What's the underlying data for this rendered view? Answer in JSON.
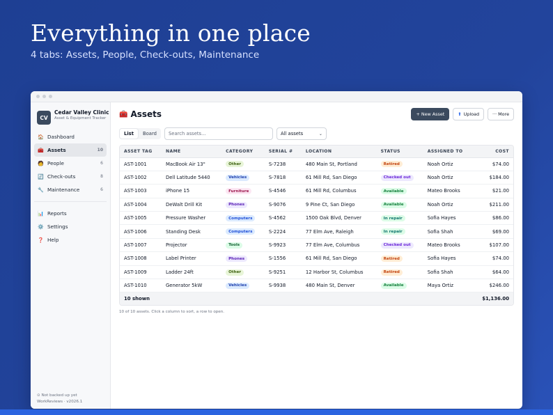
{
  "hero": {
    "title": "Everything in one place",
    "subtitle": "4 tabs: Assets, People, Check-outs, Maintenance"
  },
  "brand": {
    "logo": "CV",
    "name": "Cedar Valley Clinic",
    "subtitle": "Asset & Equipment Tracker"
  },
  "nav": {
    "primary": [
      {
        "icon": "🏠",
        "icon_name": "home-icon",
        "label": "Dashboard",
        "count": ""
      },
      {
        "icon": "🧰",
        "icon_name": "toolbox-icon",
        "label": "Assets",
        "count": "10",
        "active": true
      },
      {
        "icon": "🧑",
        "icon_name": "person-icon",
        "label": "People",
        "count": "6"
      },
      {
        "icon": "🔄",
        "icon_name": "cycle-icon",
        "label": "Check-outs",
        "count": "8"
      },
      {
        "icon": "🔧",
        "icon_name": "wrench-icon",
        "label": "Maintenance",
        "count": "6"
      }
    ],
    "secondary": [
      {
        "icon": "📊",
        "icon_name": "chart-icon",
        "label": "Reports"
      },
      {
        "icon": "⚙️",
        "icon_name": "gear-icon",
        "label": "Settings"
      },
      {
        "icon": "❓",
        "icon_name": "help-icon",
        "label": "Help"
      }
    ]
  },
  "sidebar_footer": {
    "backup": "⊙ Not backed up yet",
    "version": "WorkReviews · v2026.1"
  },
  "header": {
    "icon": "🧰",
    "title": "Assets",
    "new_button": "+ New Asset",
    "upload_icon": "⬆",
    "upload_button": "Upload",
    "more_button": "··· More"
  },
  "toolbar": {
    "view_list": "List",
    "view_board": "Board",
    "search_placeholder": "Search assets...",
    "filter_value": "All assets"
  },
  "table": {
    "columns": [
      "ASSET TAG",
      "NAME",
      "CATEGORY",
      "SERIAL #",
      "LOCATION",
      "STATUS",
      "ASSIGNED TO",
      "COST"
    ],
    "rows": [
      {
        "tag": "AST-1001",
        "name": "MacBook Air 13\"",
        "category": "Other",
        "serial": "S-7238",
        "location": "480 Main St, Portland",
        "status": "Retired",
        "assigned": "Noah Ortiz",
        "cost": "$74.00"
      },
      {
        "tag": "AST-1002",
        "name": "Dell Latitude 5440",
        "category": "Vehicles",
        "serial": "S-7818",
        "location": "61 Mill Rd, San Diego",
        "status": "Checked out",
        "assigned": "Noah Ortiz",
        "cost": "$184.00"
      },
      {
        "tag": "AST-1003",
        "name": "iPhone 15",
        "category": "Furniture",
        "serial": "S-4546",
        "location": "61 Mill Rd, Columbus",
        "status": "Available",
        "assigned": "Mateo Brooks",
        "cost": "$21.00"
      },
      {
        "tag": "AST-1004",
        "name": "DeWalt Drill Kit",
        "category": "Phones",
        "serial": "S-9076",
        "location": "9 Pine Ct, San Diego",
        "status": "Available",
        "assigned": "Noah Ortiz",
        "cost": "$211.00"
      },
      {
        "tag": "AST-1005",
        "name": "Pressure Washer",
        "category": "Computers",
        "serial": "S-4562",
        "location": "1500 Oak Blvd, Denver",
        "status": "In repair",
        "assigned": "Sofia Hayes",
        "cost": "$86.00"
      },
      {
        "tag": "AST-1006",
        "name": "Standing Desk",
        "category": "Computers",
        "serial": "S-2224",
        "location": "77 Elm Ave, Raleigh",
        "status": "In repair",
        "assigned": "Sofia Shah",
        "cost": "$69.00"
      },
      {
        "tag": "AST-1007",
        "name": "Projector",
        "category": "Tools",
        "serial": "S-9923",
        "location": "77 Elm Ave, Columbus",
        "status": "Checked out",
        "assigned": "Mateo Brooks",
        "cost": "$107.00"
      },
      {
        "tag": "AST-1008",
        "name": "Label Printer",
        "category": "Phones",
        "serial": "S-1556",
        "location": "61 Mill Rd, San Diego",
        "status": "Retired",
        "assigned": "Sofia Hayes",
        "cost": "$74.00"
      },
      {
        "tag": "AST-1009",
        "name": "Ladder 24ft",
        "category": "Other",
        "serial": "S-9251",
        "location": "12 Harbor St, Columbus",
        "status": "Retired",
        "assigned": "Sofia Shah",
        "cost": "$64.00"
      },
      {
        "tag": "AST-1010",
        "name": "Generator 5kW",
        "category": "Vehicles",
        "serial": "S-9938",
        "location": "480 Main St, Denver",
        "status": "Available",
        "assigned": "Maya Ortiz",
        "cost": "$246.00"
      }
    ],
    "footer_count": "10 shown",
    "footer_total": "$1,136.00"
  },
  "hint": "10 of 10 assets. Click a column to sort, a row to open.",
  "colors": {
    "category": {
      "Other": {
        "bg": "#e8f5d8",
        "fg": "#3f6212"
      },
      "Vehicles": {
        "bg": "#dbeafe",
        "fg": "#1e40af"
      },
      "Furniture": {
        "bg": "#fce7f3",
        "fg": "#9d174d"
      },
      "Phones": {
        "bg": "#ede9fe",
        "fg": "#5b21b6"
      },
      "Computers": {
        "bg": "#dbeafe",
        "fg": "#1d4ed8"
      },
      "Tools": {
        "bg": "#dcfce7",
        "fg": "#166534"
      }
    },
    "status": {
      "Retired": {
        "bg": "#ffedd5",
        "fg": "#c2410c"
      },
      "Checked out": {
        "bg": "#ede9fe",
        "fg": "#6d28d9"
      },
      "Available": {
        "bg": "#dcfce7",
        "fg": "#15803d"
      },
      "In repair": {
        "bg": "#dcfce7",
        "fg": "#0f766e"
      }
    }
  }
}
